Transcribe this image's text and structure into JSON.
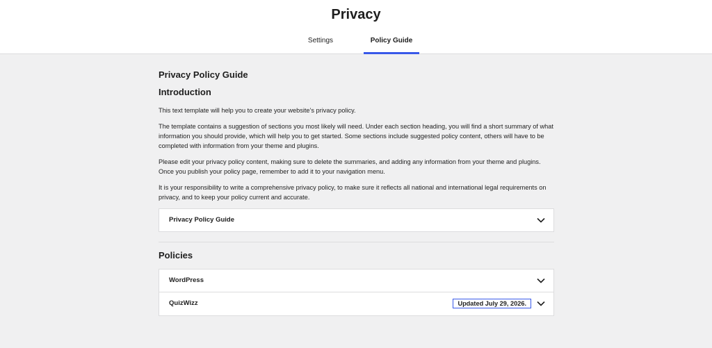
{
  "header": {
    "title": "Privacy",
    "tabs": {
      "settings": "Settings",
      "guide": "Policy Guide"
    }
  },
  "main": {
    "heading": "Privacy Policy Guide",
    "intro_heading": "Introduction",
    "paragraphs": [
      "This text template will help you to create your website’s privacy policy.",
      "The template contains a suggestion of sections you most likely will need. Under each section heading, you will find a short summary of what information you should provide, which will help you to get started. Some sections include suggested policy content, others will have to be completed with information from your theme and plugins.",
      "Please edit your privacy policy content, making sure to delete the summaries, and adding any information from your theme and plugins. Once you publish your policy page, remember to add it to your navigation menu.",
      "It is your responsibility to write a comprehensive privacy policy, to make sure it reflects all national and international legal requirements on privacy, and to keep your policy current and accurate."
    ],
    "guide_accordion_label": "Privacy Policy Guide",
    "policies_heading": "Policies",
    "policies": [
      {
        "name": "WordPress",
        "badge": ""
      },
      {
        "name": "QuizWizz",
        "badge": "Updated July 29, 2026."
      }
    ]
  },
  "colors": {
    "accent": "#3858e9",
    "background": "#f0f0f1",
    "border": "#dcdcde"
  }
}
